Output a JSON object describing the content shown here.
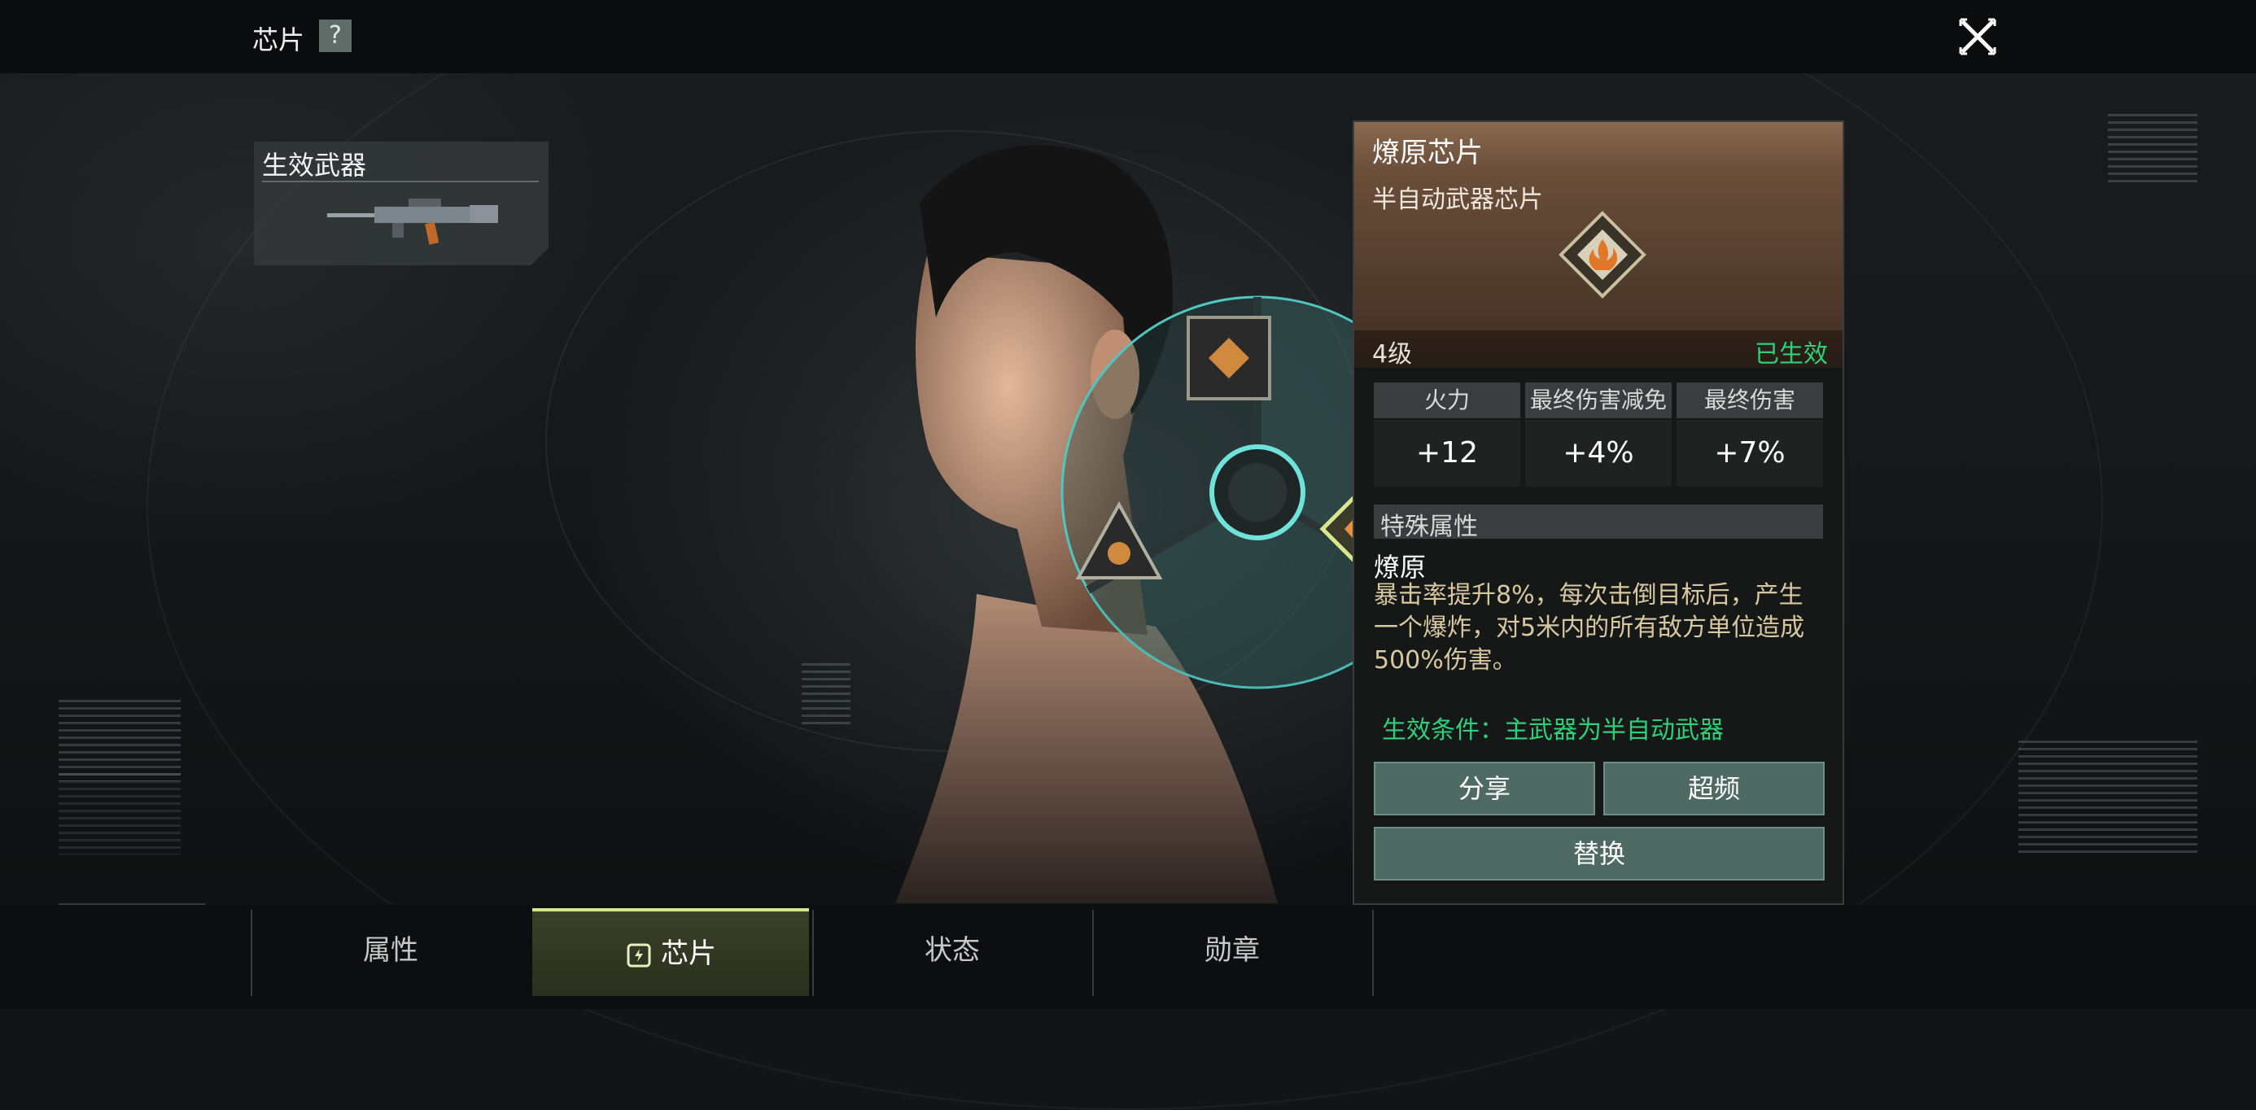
{
  "header": {
    "title": "芯片",
    "help_label": "?"
  },
  "weapon_panel": {
    "label": "生效武器"
  },
  "chip_detail": {
    "name": "燎原芯片",
    "type": "半自动武器芯片",
    "level": "4级",
    "status": "已生效",
    "stats": [
      {
        "label": "火力",
        "value": "+12"
      },
      {
        "label": "最终伤害减免",
        "value": "+4%"
      },
      {
        "label": "最终伤害",
        "value": "+7%"
      }
    ],
    "special": {
      "header": "特殊属性",
      "name": "燎原",
      "desc_line1": "暴击率提升8%，每次击倒目标后，产生",
      "desc_line2": "一个爆炸，对5米内的所有敌方单位造成",
      "desc_line3": "500%伤害。"
    },
    "condition": "生效条件：主武器为半自动武器",
    "buttons": {
      "share": "分享",
      "overclock": "超频",
      "replace": "替换"
    }
  },
  "tabs": [
    {
      "label": "属性",
      "active": false
    },
    {
      "label": "芯片",
      "active": true
    },
    {
      "label": "状态",
      "active": false
    },
    {
      "label": "勋章",
      "active": false
    }
  ],
  "colors": {
    "accent_green": "#2fd07a",
    "tab_active": "#d7e68a",
    "button": "#4e6a62",
    "chip_header": "#8a6a50"
  }
}
